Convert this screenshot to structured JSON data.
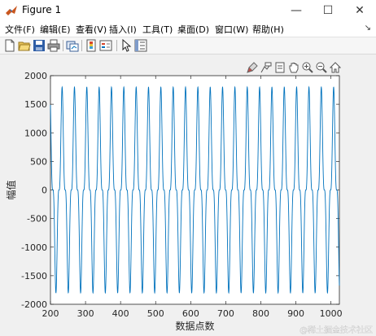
{
  "window": {
    "title": "Figure 1",
    "minimize_glyph": "—",
    "maximize_glyph": "☐",
    "close_glyph": "✕"
  },
  "menu": {
    "items": [
      "文件(F)",
      "编辑(E)",
      "查看(V)",
      "插入(I)",
      "工具(T)",
      "桌面(D)",
      "窗口(W)",
      "帮助(H)"
    ]
  },
  "toolbar_icons": [
    "new-figure-icon",
    "open-file-icon",
    "save-icon",
    "print-icon",
    "link-plot-icon",
    "colorbar-icon",
    "legend-icon",
    "pointer-icon",
    "property-inspector-icon"
  ],
  "axes_toolbar_icons": [
    "brush-icon",
    "data-tips-icon",
    "export-icon",
    "pan-icon",
    "zoom-in-icon",
    "zoom-out-icon",
    "home-icon"
  ],
  "colors": {
    "line": "#0072bd",
    "axes_bg": "#ffffff",
    "figure_bg": "#f0f0f0"
  },
  "watermark": "@稀土掘金技术社区",
  "chart_data": {
    "type": "line",
    "xlabel": "数据点数",
    "ylabel": "幅值",
    "xlim": [
      200,
      1024
    ],
    "ylim": [
      -2000,
      2000
    ],
    "xticks": [
      200,
      300,
      400,
      500,
      600,
      700,
      800,
      900,
      1000
    ],
    "yticks": [
      2000,
      1500,
      1000,
      500,
      0,
      -500,
      -1000,
      -1500,
      -2000
    ],
    "series": [
      {
        "signal": "periodic",
        "period": 35.2,
        "x_range": [
          200,
          1024
        ],
        "peak_max": 1800,
        "peak_min": -1800,
        "secondary_peak_max": 370,
        "secondary_peak_min": -370
      }
    ]
  }
}
